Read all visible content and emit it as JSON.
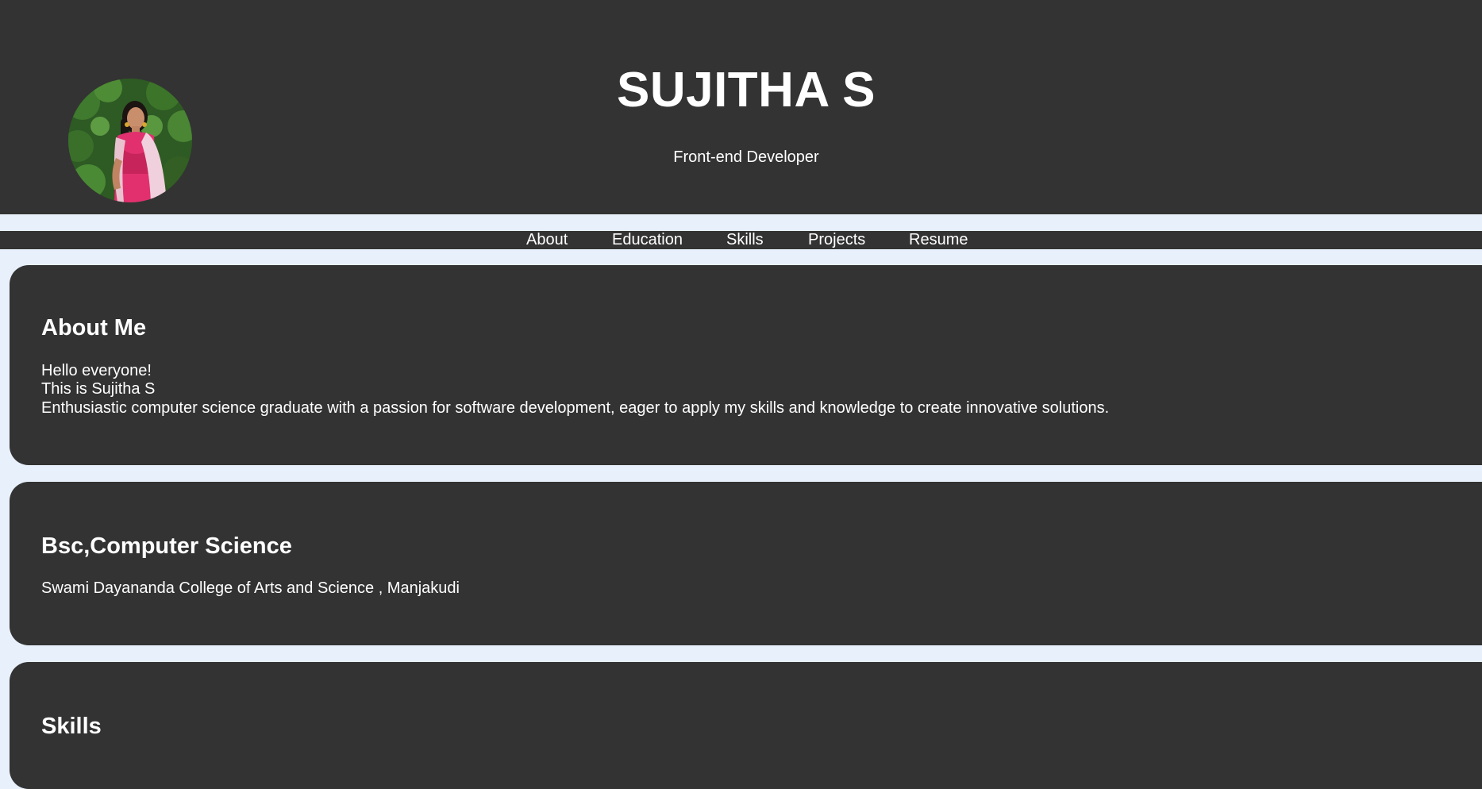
{
  "header": {
    "name": "SUJITHA S",
    "subtitle": "Front-end Developer"
  },
  "nav": {
    "items": [
      "About",
      "Education",
      "Skills",
      "Projects",
      "Resume"
    ]
  },
  "about": {
    "title": "About Me",
    "line1": "Hello everyone!",
    "line2": "This is Sujitha S",
    "line3": "Enthusiastic computer science graduate with a passion for software development, eager to apply my skills and knowledge to create innovative solutions."
  },
  "education": {
    "title": "Bsc,Computer Science",
    "institution": "Swami Dayananda College of Arts and Science , Manjakudi"
  },
  "skills": {
    "title": "Skills"
  },
  "colors": {
    "page_background": "#e8f1fb",
    "panel_background": "#333333",
    "text": "#ffffff"
  }
}
